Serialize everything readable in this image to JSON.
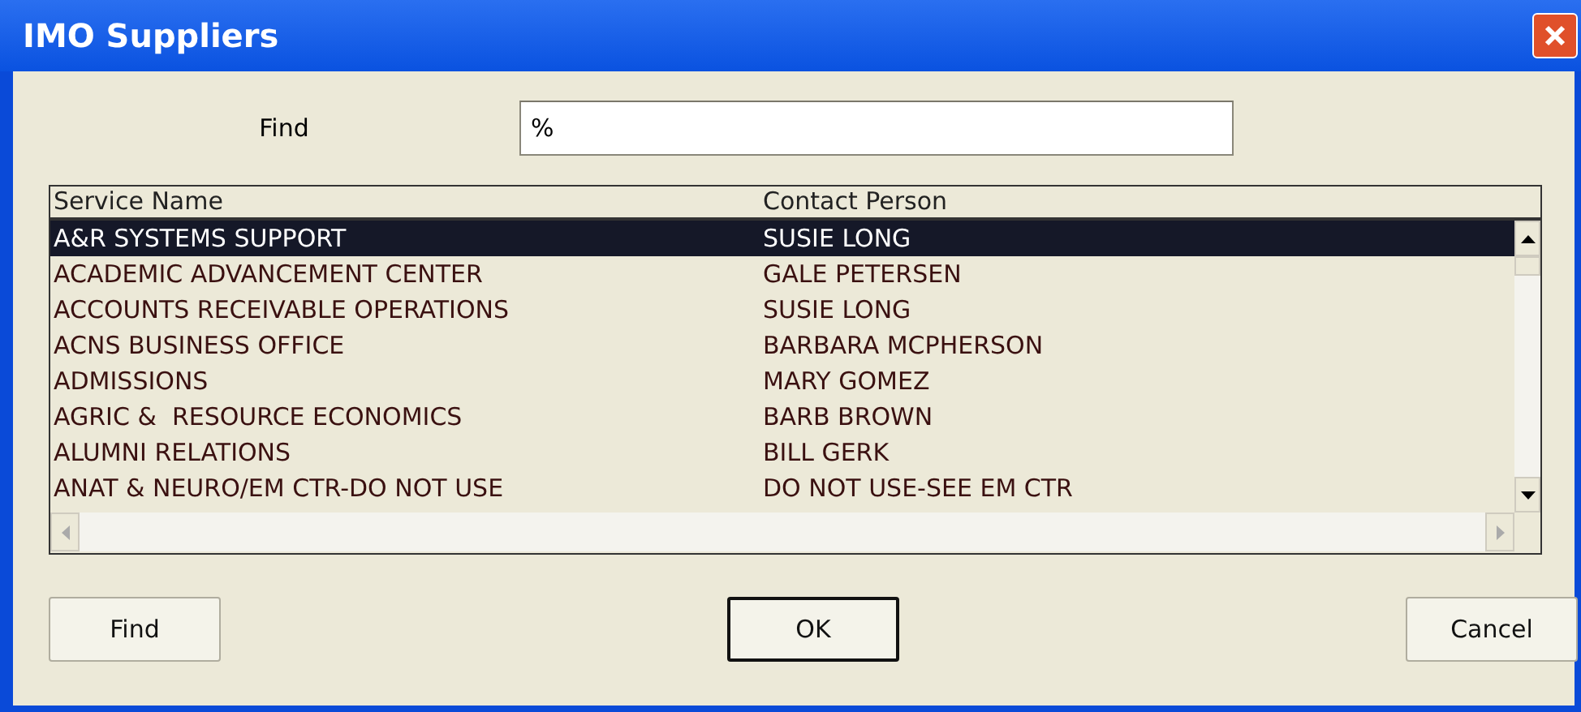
{
  "window": {
    "title": "IMO Suppliers"
  },
  "find": {
    "label": "Find",
    "value": "%"
  },
  "table": {
    "columns": [
      "Service Name",
      "Contact Person"
    ],
    "rows": [
      {
        "service": "A&R SYSTEMS SUPPORT",
        "contact": "SUSIE LONG",
        "selected": true
      },
      {
        "service": "ACADEMIC ADVANCEMENT CENTER",
        "contact": "GALE PETERSEN",
        "selected": false
      },
      {
        "service": "ACCOUNTS RECEIVABLE OPERATIONS",
        "contact": "SUSIE LONG",
        "selected": false
      },
      {
        "service": "ACNS BUSINESS OFFICE",
        "contact": "BARBARA MCPHERSON",
        "selected": false
      },
      {
        "service": "ADMISSIONS",
        "contact": "MARY GOMEZ",
        "selected": false
      },
      {
        "service": "AGRIC &  RESOURCE ECONOMICS",
        "contact": "BARB BROWN",
        "selected": false
      },
      {
        "service": "ALUMNI RELATIONS",
        "contact": "BILL GERK",
        "selected": false
      },
      {
        "service": "ANAT & NEURO/EM CTR-DO NOT USE",
        "contact": "DO NOT USE-SEE EM CTR",
        "selected": false
      }
    ]
  },
  "buttons": [
    {
      "label": "Find",
      "default": false
    },
    {
      "label": "OK",
      "default": true
    },
    {
      "label": "Cancel",
      "default": false
    }
  ]
}
